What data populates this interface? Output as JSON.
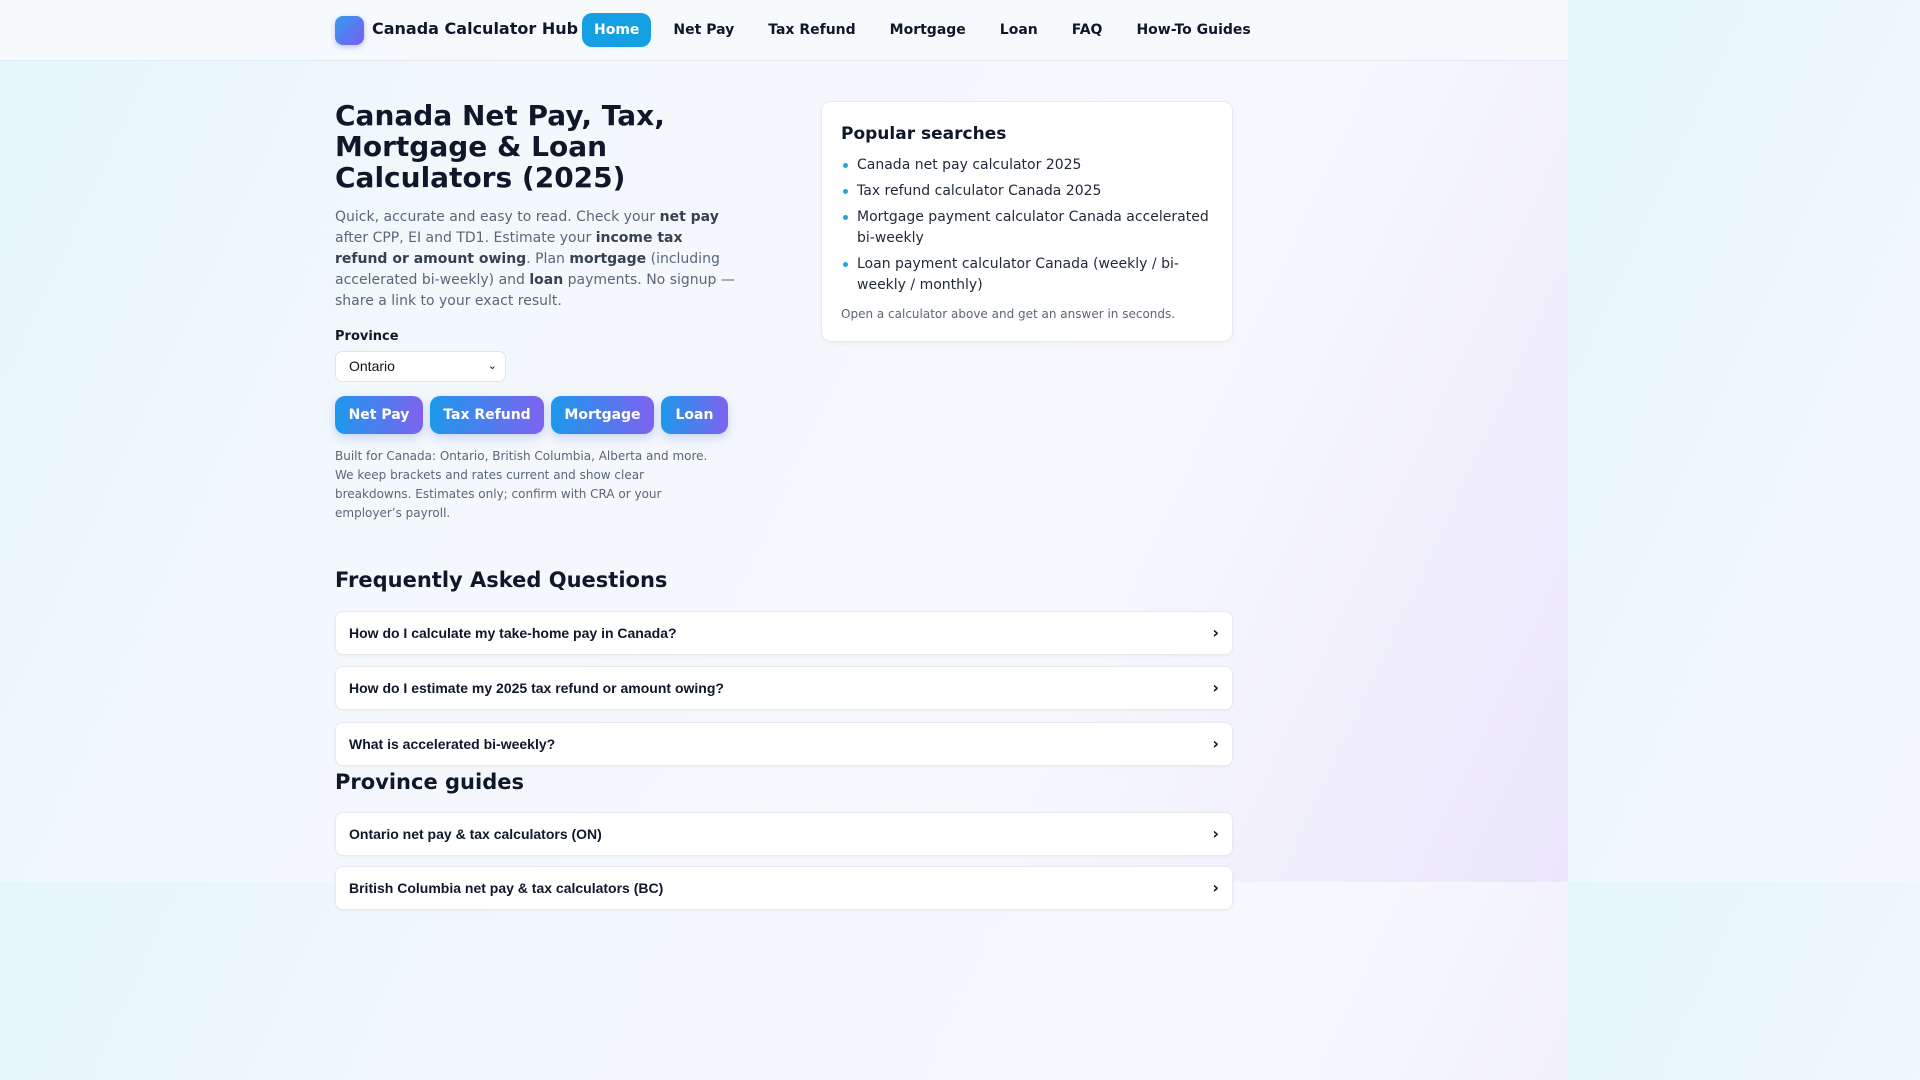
{
  "brand": {
    "name": "Canada Calculator Hub"
  },
  "nav": [
    {
      "label": "Home",
      "active": true
    },
    {
      "label": "Net Pay",
      "active": false
    },
    {
      "label": "Tax Refund",
      "active": false
    },
    {
      "label": "Mortgage",
      "active": false
    },
    {
      "label": "Loan",
      "active": false
    },
    {
      "label": "FAQ",
      "active": false
    },
    {
      "label": "How-To Guides",
      "active": false
    }
  ],
  "hero": {
    "title": "Canada Net Pay, Tax, Mortgage & Loan Calculators (2025)",
    "desc": {
      "p1": "Quick, accurate and easy to read. Check your ",
      "b1": "net pay",
      "p2": " after CPP, EI and TD1. Estimate your ",
      "b2": "income tax refund or amount owing",
      "p3": ". Plan ",
      "b3": "mortgage",
      "p4": " (including accelerated bi-weekly) and ",
      "b4": "loan",
      "p5": " payments. No signup — share a link to your exact result."
    },
    "province_label": "Province",
    "province_value": "Ontario",
    "buttons": [
      "Net Pay",
      "Tax Refund",
      "Mortgage",
      "Loan"
    ],
    "note": "Built for Canada: Ontario, British Columbia, Alberta and more. We keep brackets and rates current and show clear breakdowns. Estimates only; confirm with CRA or your employer’s payroll."
  },
  "popular": {
    "title": "Popular searches",
    "items": [
      "Canada net pay calculator 2025",
      "Tax refund calculator Canada 2025",
      "Mortgage payment calculator Canada accelerated bi-weekly",
      "Loan payment calculator Canada (weekly / bi-weekly / monthly)"
    ],
    "note": "Open a calculator above and get an answer in seconds."
  },
  "faq": {
    "title": "Frequently Asked Questions",
    "items": [
      "How do I calculate my take-home pay in Canada?",
      "How do I estimate my 2025 tax refund or amount owing?",
      "What is accelerated bi-weekly?"
    ]
  },
  "guides": {
    "title": "Province guides",
    "items": [
      "Ontario net pay & tax calculators (ON)",
      "British Columbia net pay & tax calculators (BC)"
    ]
  },
  "icons": {
    "chevron": "›",
    "select": "⌄"
  },
  "colors": {
    "accent": "#14a0e3",
    "gradient_start": "#1c98ec",
    "gradient_end": "#7e63ee",
    "bullet": "#22a5dc"
  }
}
